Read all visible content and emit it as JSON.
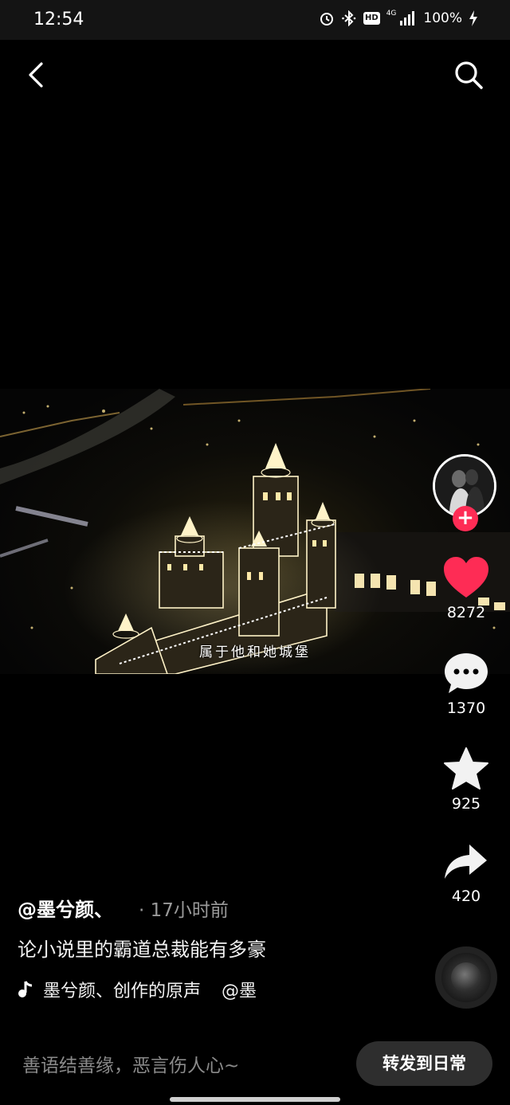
{
  "status_bar": {
    "time": "12:54",
    "network": "4G",
    "hd": "HD",
    "battery": "100%"
  },
  "nav": {
    "back_icon": "chevron-left-icon",
    "search_icon": "search-icon"
  },
  "video": {
    "subtitle": "属于他和她城堡"
  },
  "actions": {
    "likes": "8272",
    "comments": "1370",
    "favorites": "925",
    "shares": "420",
    "like_color": "#fe2c55"
  },
  "post": {
    "author": "@墨兮颜、",
    "time": "· 17小时前",
    "caption": "论小说里的霸道总裁能有多豪",
    "music": "墨兮颜、创作的原声",
    "music_mention": "@墨"
  },
  "bottom": {
    "comment_placeholder": "善语结善缘，恶言伤人心~",
    "repost_label": "转发到日常"
  }
}
